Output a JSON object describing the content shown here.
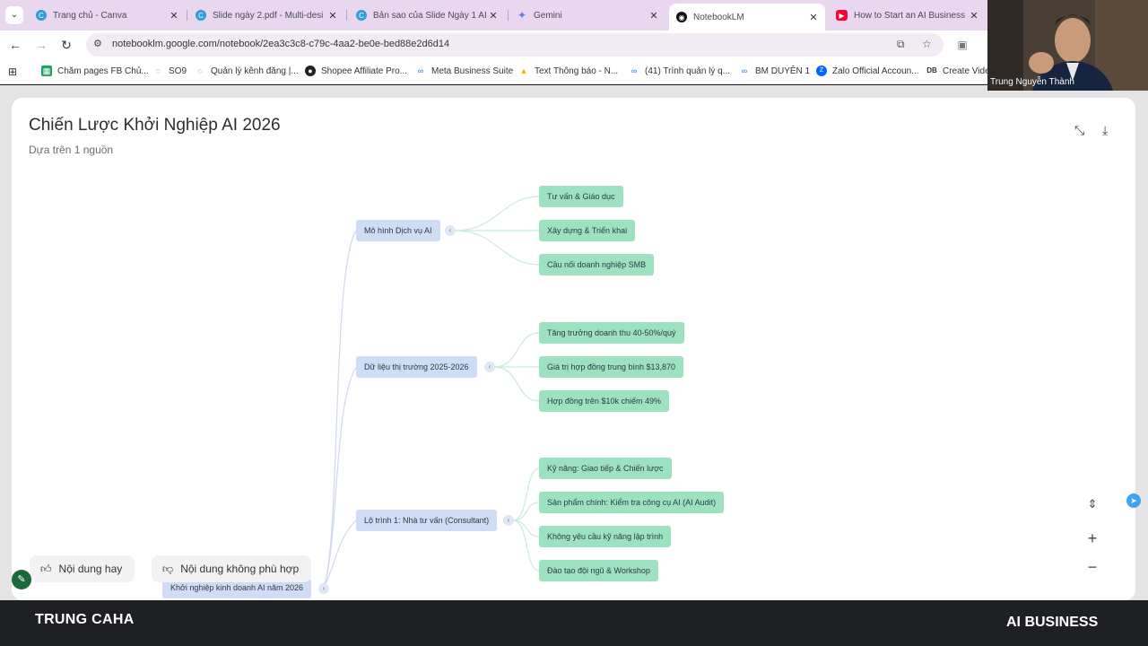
{
  "browser": {
    "tabs": [
      {
        "title": "Trang chủ - Canva",
        "icon": "canva-icon",
        "icon_color": "#2f9ed9"
      },
      {
        "title": "Slide ngày 2.pdf - Multi-desi",
        "icon": "canva-icon",
        "icon_color": "#2f9ed9"
      },
      {
        "title": "Bản sao của Slide Ngày 1 AI",
        "icon": "canva-icon",
        "icon_color": "#2f9ed9"
      },
      {
        "title": "Gemini",
        "icon": "gemini-icon",
        "icon_color": "#5b7ff0"
      },
      {
        "title": "NotebookLM",
        "icon": "notebooklm-icon",
        "icon_color": "#111111"
      },
      {
        "title": "How to Start an AI Business",
        "icon": "youtube-icon",
        "icon_color": "#ff0033"
      }
    ],
    "active_tab_index": 4,
    "url": "notebooklm.google.com/notebook/2ea3c3c8-c79c-4aa2-be0e-bed88e2d6d14",
    "bookmarks": [
      {
        "label": "Chăm pages FB Chủ...",
        "icon": "sheets-icon",
        "color": "#1fa463"
      },
      {
        "label": "SO9",
        "icon": "globe-icon",
        "color": "#555555"
      },
      {
        "label": "Quản lý kênh đăng |...",
        "icon": "globe-icon",
        "color": "#555555"
      },
      {
        "label": "Shopee Affiliate Pro...",
        "icon": "github-icon",
        "color": "#222222"
      },
      {
        "label": "Meta Business Suite",
        "icon": "meta-icon",
        "color": "#1877f2"
      },
      {
        "label": "Text Thông báo - N...",
        "icon": "drive-icon",
        "color": "#f4b400"
      },
      {
        "label": "(41) Trình quản lý q...",
        "icon": "meta-icon",
        "color": "#1877f2"
      },
      {
        "label": "BM DUYÊN 1",
        "icon": "meta-icon",
        "color": "#1877f2"
      },
      {
        "label": "Zalo Official Accoun...",
        "icon": "zalo-icon",
        "color": "#0068ff"
      },
      {
        "label": "Create Vide",
        "icon": "video-icon",
        "color": "#333333"
      }
    ]
  },
  "mindmap": {
    "title": "Chiến Lược Khởi Nghiệp AI 2026",
    "subtitle": "Dựa trên 1 nguồn",
    "root": "Khởi nghiệp kinh doanh AI năm 2026",
    "branches": [
      {
        "label": "Mô hình Dịch vụ AI",
        "children": [
          "Tư vấn & Giáo dục",
          "Xây dựng & Triển khai",
          "Cầu nối doanh nghiệp SMB"
        ]
      },
      {
        "label": "Dữ liệu thị trường 2025-2026",
        "children": [
          "Tăng trưởng doanh thu 40-50%/quý",
          "Giá trị hợp đồng trung bình $13,870",
          "Hợp đồng trên $10k chiếm 49%"
        ]
      },
      {
        "label": "Lộ trình 1: Nhà tư vấn (Consultant)",
        "children": [
          "Kỹ năng: Giao tiếp & Chiến lược",
          "Sản phẩm chính: Kiểm tra công cụ AI (AI Audit)",
          "Không yêu cầu kỹ năng lập trình",
          "Đào tạo đội ngũ & Workshop"
        ]
      }
    ]
  },
  "feedback": {
    "good": "Nội dung hay",
    "bad": "Nội dung không phù hợp"
  },
  "webcam": {
    "name": "Trung Nguyễn Thành"
  },
  "banner": {
    "left": "TRUNG CAHA",
    "right": "AI BUSINESS"
  },
  "colors": {
    "branch_node": "#cfdcf5",
    "leaf_node": "#9de2c0",
    "tab_strip": "#e9d7f0"
  }
}
